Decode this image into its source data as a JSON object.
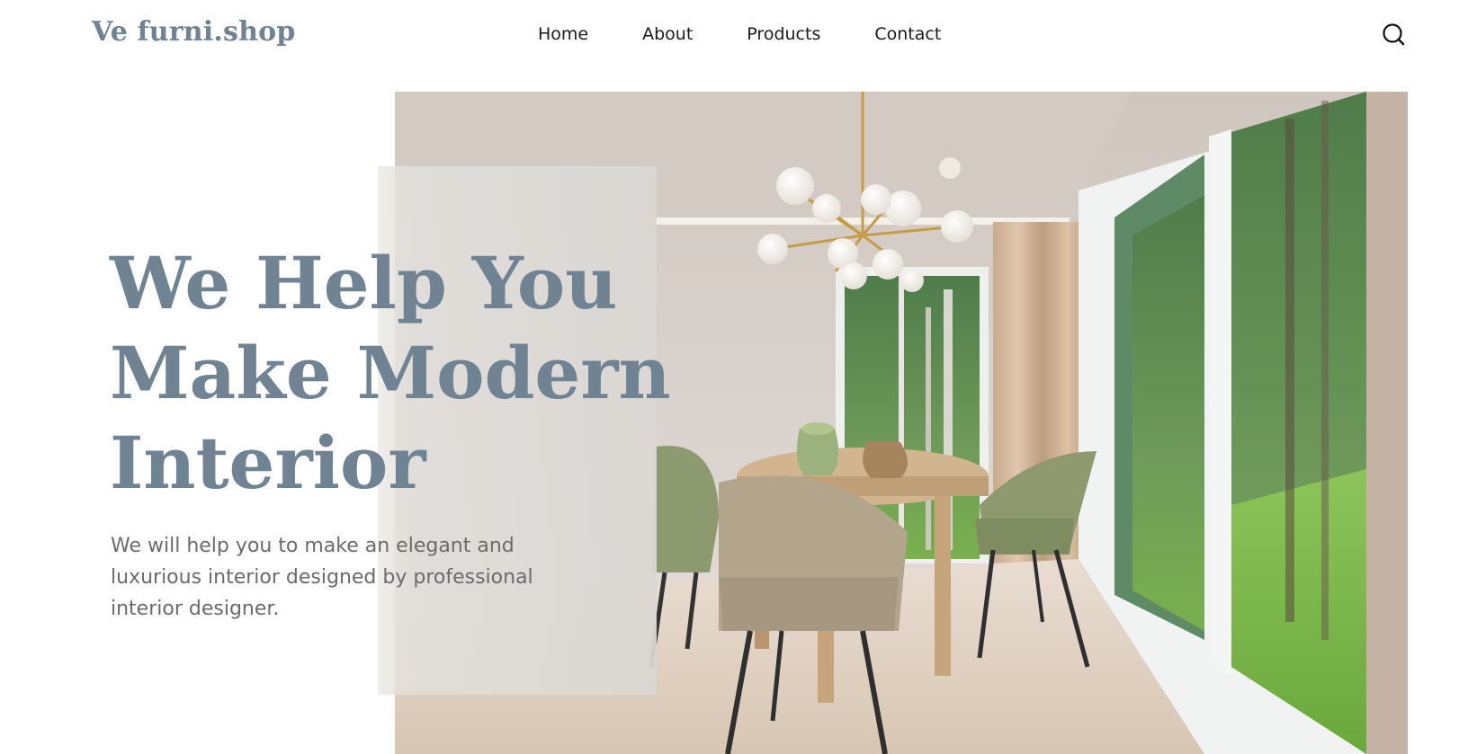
{
  "brand": {
    "logo_text": "Ve furni.shop",
    "primary_color": "#6f8393"
  },
  "nav": {
    "items": [
      {
        "label": "Home"
      },
      {
        "label": "About"
      },
      {
        "label": "Products"
      },
      {
        "label": "Contact"
      }
    ],
    "search_icon": "search-icon"
  },
  "hero": {
    "title_lines": [
      "We Help You",
      "Make Modern",
      "Interior"
    ],
    "subtitle": "We will help you to make an elegant and luxurious interior designed by professional interior designer.",
    "image": "dining-room-photo"
  }
}
